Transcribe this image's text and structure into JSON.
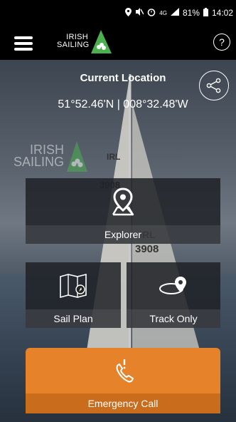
{
  "status_bar": {
    "battery": "81%",
    "time": "14:02",
    "icons": [
      "location-icon",
      "mute-icon",
      "alarm-icon",
      "data-4g-icon",
      "signal-icon",
      "battery-icon"
    ]
  },
  "header": {
    "logo_line1": "IRISH",
    "logo_line2": "SAILING",
    "help_label": "?"
  },
  "location": {
    "title": "Current Location",
    "coords": "51°52.46'N | 008°32.48'W"
  },
  "watermark": {
    "line1": "IRISH",
    "line2": "SAILING"
  },
  "tiles": {
    "explorer": "Explorer",
    "sail_plan": "Sail Plan",
    "track_only": "Track Only",
    "emergency": "Emergency Call"
  },
  "colors": {
    "accent": "#e6822a",
    "header": "#000000",
    "logo_green": "#4caf50"
  }
}
